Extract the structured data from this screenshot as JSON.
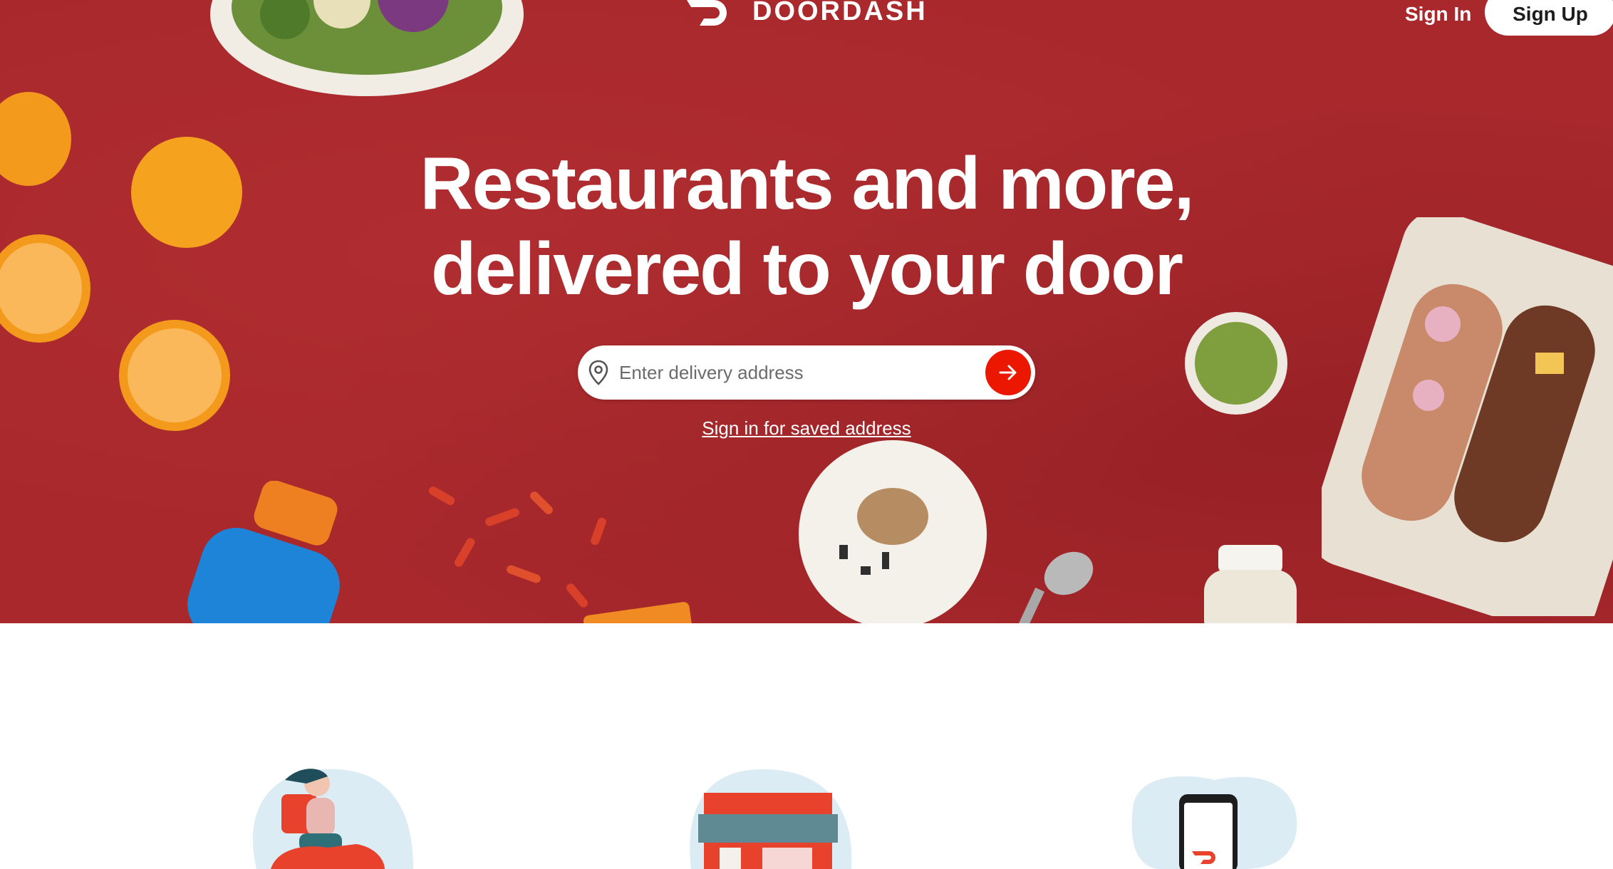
{
  "header": {
    "brand": "DOORDASH",
    "sign_in": "Sign In",
    "sign_up": "Sign Up"
  },
  "hero": {
    "headline_line1": "Restaurants and more,",
    "headline_line2": "delivered to your door",
    "address_placeholder": "Enter delivery address",
    "saved_address_link": "Sign in for saved address"
  },
  "icons": {
    "logo": "doordash-logo-icon",
    "location": "location-pin-icon",
    "submit": "arrow-right-icon"
  },
  "colors": {
    "hero_background": "#a8282c",
    "accent": "#eb1700",
    "white": "#ffffff"
  }
}
